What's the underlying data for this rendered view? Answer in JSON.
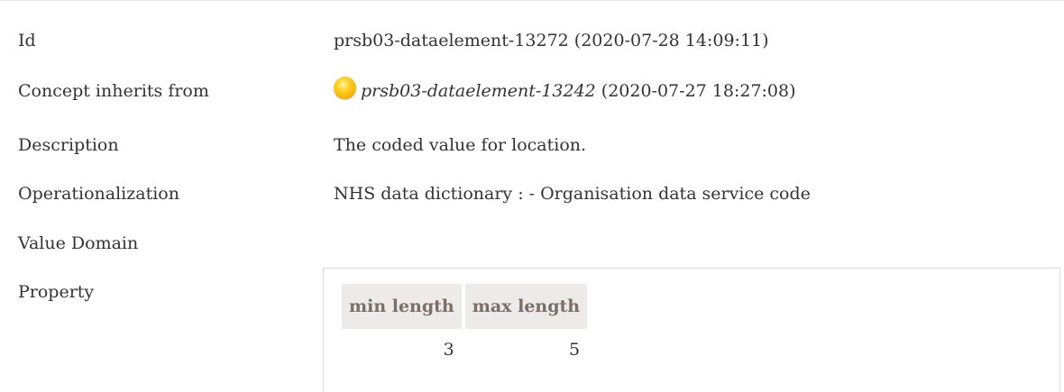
{
  "rows": {
    "id": {
      "label": "Id",
      "value": "prsb03-dataelement-13272 (2020-07-28 14:09:11)"
    },
    "inherits": {
      "label": "Concept inherits from",
      "link": "prsb03-dataelement-13242",
      "date": "(2020-07-27 18:27:08)",
      "status_icon": "yellow-circle-status-icon",
      "status_color": "#f4b400"
    },
    "description": {
      "label": "Description",
      "value": "The coded value for location."
    },
    "operationalization": {
      "label": "Operationalization",
      "value": "NHS data dictionary : - Organisation data service code"
    },
    "value_domain": {
      "label": "Value Domain"
    },
    "property": {
      "label": "Property",
      "columns": [
        "min length",
        "max length"
      ],
      "values": [
        "3",
        "5"
      ]
    }
  },
  "colors": {
    "header_bg": "#ecebea",
    "header_text": "#7a6e66",
    "text": "#333333"
  }
}
